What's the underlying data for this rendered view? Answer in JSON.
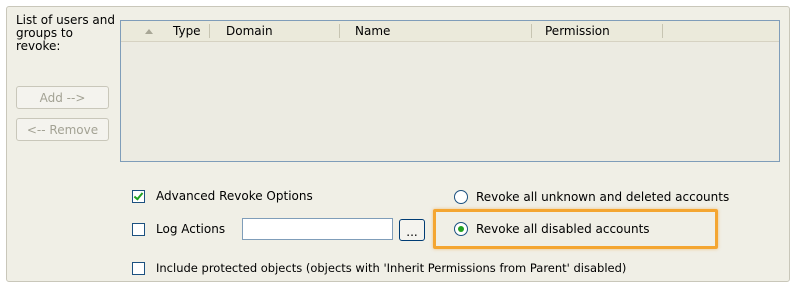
{
  "revoke_panel": {
    "list_label": "List of users and groups to revoke:",
    "add_button": "Add -->",
    "remove_button": "<-- Remove",
    "columns": [
      "Type",
      "Domain",
      "Name",
      "Permission"
    ]
  },
  "options": {
    "advanced_revoke": {
      "label": "Advanced Revoke Options",
      "checked": true
    },
    "log_actions": {
      "label": "Log Actions",
      "checked": false,
      "value": "",
      "browse_label": "..."
    },
    "revoke_unknown": {
      "label": "Revoke all unknown and deleted accounts",
      "selected": false
    },
    "revoke_disabled": {
      "label": "Revoke all disabled accounts",
      "selected": true
    },
    "include_protected": {
      "label": "Include protected objects (objects with 'Inherit Permissions from Parent' disabled)",
      "checked": false
    }
  },
  "colors": {
    "highlight": "#f4a632",
    "check_mark": "#21a121",
    "panel_bg": "#f0efe6"
  }
}
